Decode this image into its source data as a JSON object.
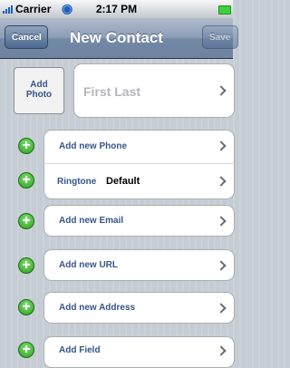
{
  "status": {
    "carrier": "Carrier",
    "time": "2:17 PM"
  },
  "nav": {
    "title": "New Contact",
    "cancel": "Cancel",
    "save": "Save"
  },
  "photo": {
    "line1": "Add",
    "line2": "Photo"
  },
  "name": {
    "placeholder": "First Last"
  },
  "rows": {
    "phone": "Add new Phone",
    "ringtone_label": "Ringtone",
    "ringtone_value": "Default",
    "email": "Add new Email",
    "url": "Add new URL",
    "address": "Add new Address",
    "field": "Add Field"
  },
  "colors": {
    "accent": "#385487",
    "add_green": "#2e9d22"
  },
  "icons": [
    "signal-icon",
    "wifi-icon",
    "battery-icon",
    "add-icon",
    "chevron-right-icon"
  ]
}
